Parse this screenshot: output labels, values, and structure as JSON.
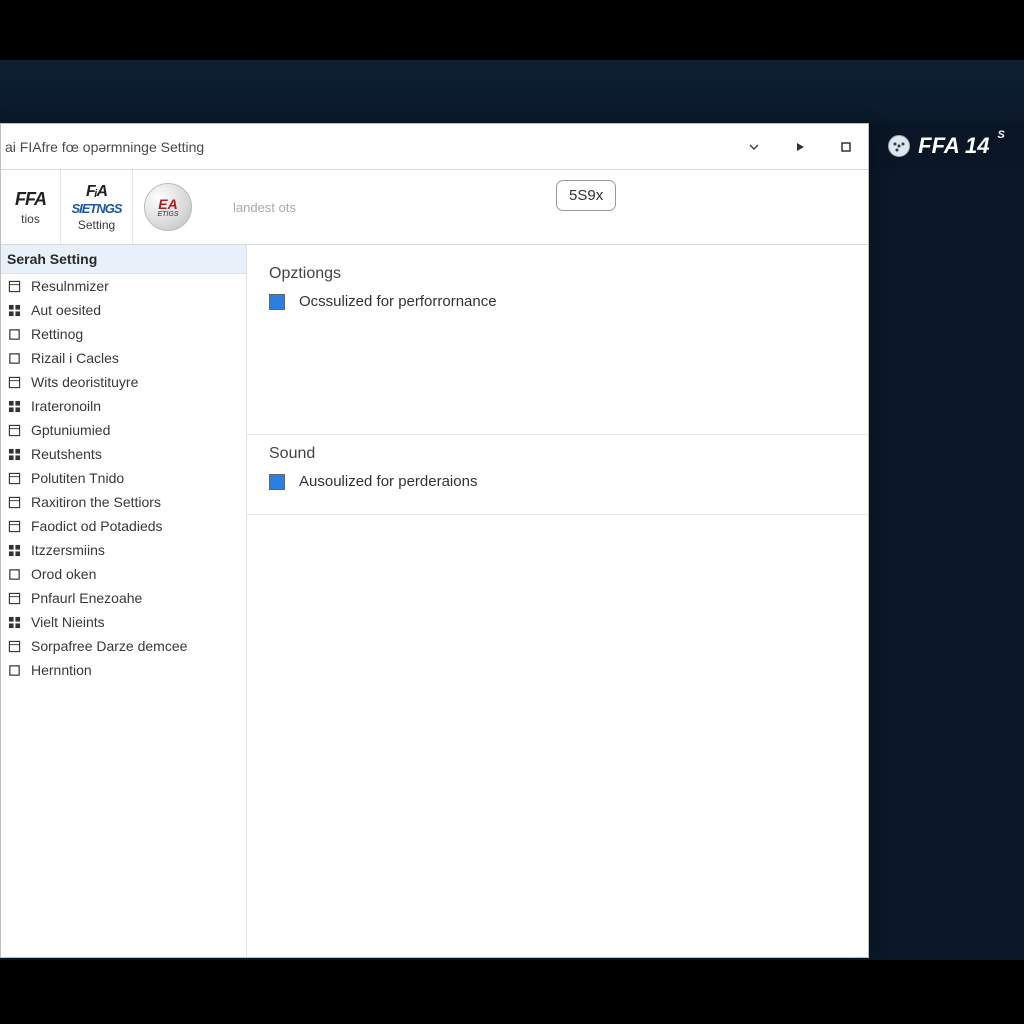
{
  "window": {
    "title": "ai FIAfre fœ opərmninge Setting"
  },
  "titlebar_icons": {
    "dropdown": "▾",
    "play": "▶",
    "maximize": "□"
  },
  "brand": {
    "text": "FFA 14",
    "badge": "S"
  },
  "headertabs": [
    {
      "big": "FFA",
      "sub": "tios",
      "style": "dark"
    },
    {
      "big": "FᵢA",
      "big2": "SIETNGS",
      "sub": "Setting",
      "style": "blue"
    },
    {
      "logo": "EA",
      "logo_sub": "ETIGS"
    }
  ],
  "header": {
    "faint_label": "landest ots",
    "pill": "5S9x"
  },
  "sidebar": {
    "header": "Serah Setting",
    "items": [
      {
        "icon": "box",
        "label": "Resulnmizer"
      },
      {
        "icon": "grid",
        "label": "Aut oesited"
      },
      {
        "icon": "square",
        "label": "Rettinog"
      },
      {
        "icon": "square",
        "label": "Rizail i Cacles"
      },
      {
        "icon": "box",
        "label": "Wits deoristituyre"
      },
      {
        "icon": "grid",
        "label": "Irateronoiln"
      },
      {
        "icon": "box",
        "label": "Gptuniumied"
      },
      {
        "icon": "grid",
        "label": "Reutshents"
      },
      {
        "icon": "box",
        "label": "Polutiten Tnido"
      },
      {
        "icon": "box",
        "label": "Raxitiron the Settiors"
      },
      {
        "icon": "box",
        "label": "Faodict od Potadieds"
      },
      {
        "icon": "grid",
        "label": "Itzzersmiins"
      },
      {
        "icon": "square",
        "label": "Orod oken"
      },
      {
        "icon": "box",
        "label": "Pnfaurl Enezoahe"
      },
      {
        "icon": "grid",
        "label": "Vielt Nieints"
      },
      {
        "icon": "box",
        "label": "Sorpafree Darze demcee"
      },
      {
        "icon": "square",
        "label": "Hernntion"
      }
    ]
  },
  "sections": [
    {
      "title": "Opztiongs",
      "option": "Ocssulized for perforrornance",
      "checked": true
    },
    {
      "title": "Sound",
      "option": "Ausoulized for perderaions",
      "checked": true
    }
  ]
}
